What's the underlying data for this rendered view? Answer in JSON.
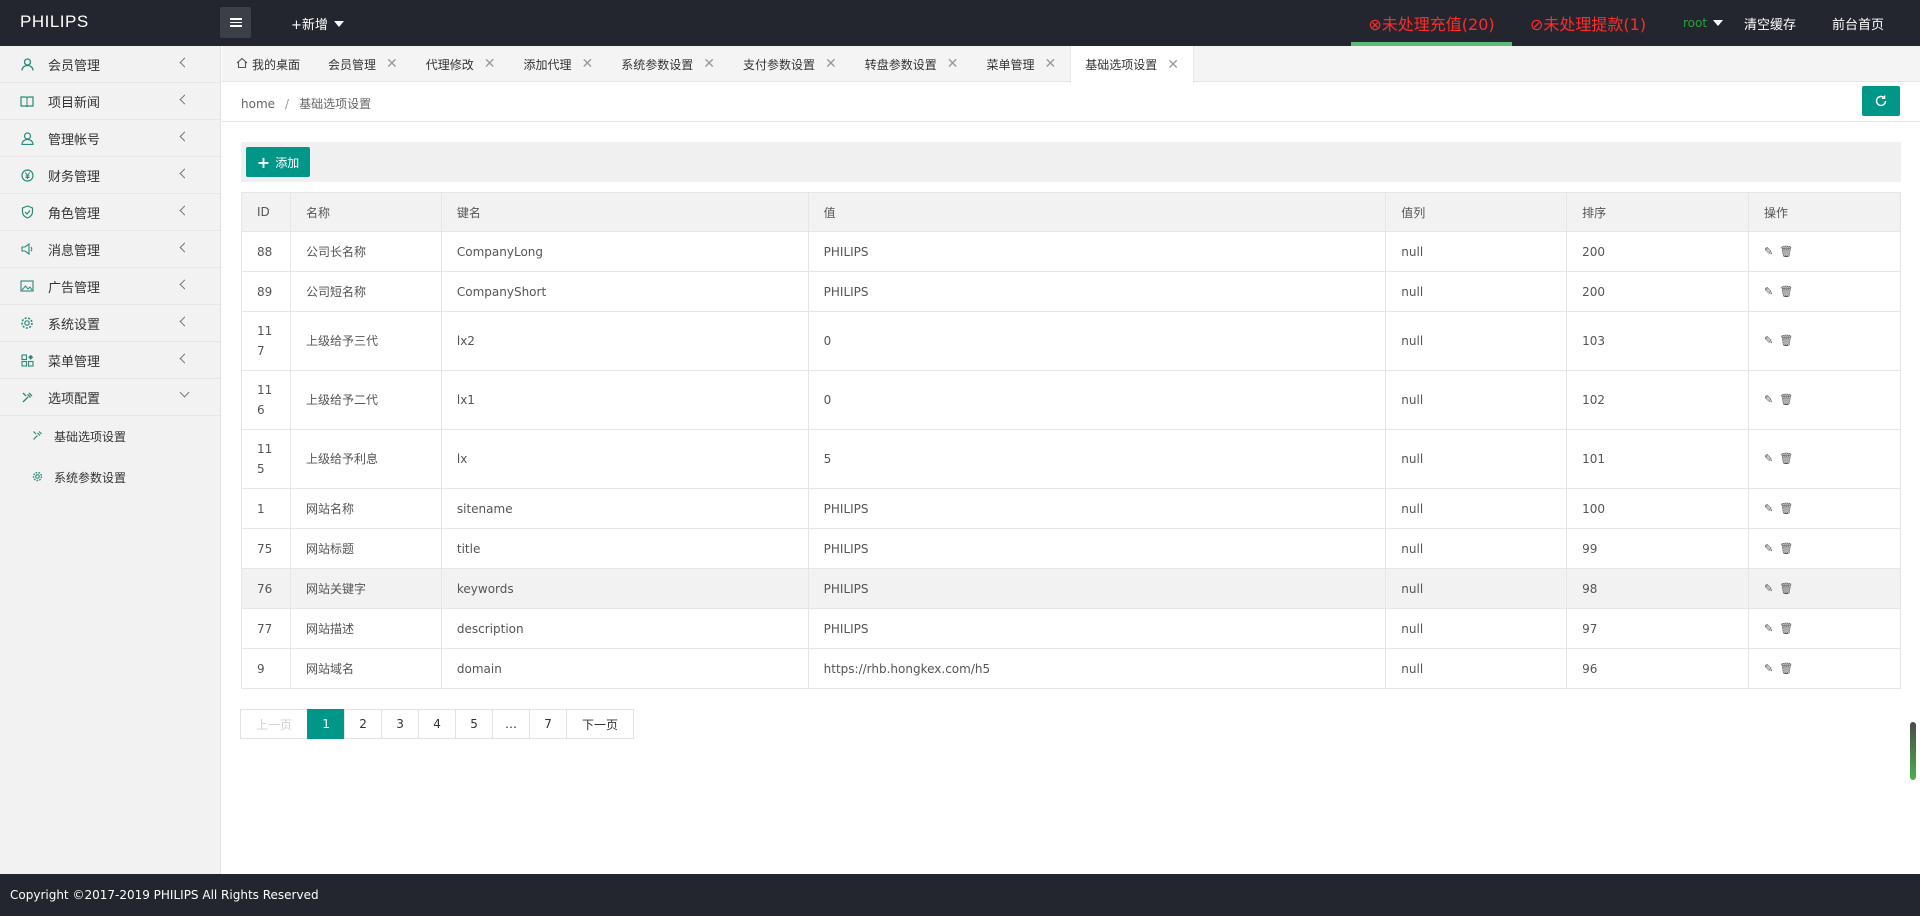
{
  "header": {
    "brand": "PHILIPS",
    "add_new": "+新增",
    "alert_recharge": "⊗未处理充值(20)",
    "alert_withdraw": "⊘未处理提款(1)",
    "user": "root",
    "clear_cache": "清空缓存",
    "front_home": "前台首页"
  },
  "sidebar": {
    "items": [
      {
        "label": "会员管理",
        "icon": "user-icon"
      },
      {
        "label": "项目新闻",
        "icon": "book-icon"
      },
      {
        "label": "管理帐号",
        "icon": "account-icon"
      },
      {
        "label": "财务管理",
        "icon": "yen-icon"
      },
      {
        "label": "角色管理",
        "icon": "shield-icon"
      },
      {
        "label": "消息管理",
        "icon": "speaker-icon"
      },
      {
        "label": "广告管理",
        "icon": "image-icon"
      },
      {
        "label": "系统设置",
        "icon": "gear-icon"
      },
      {
        "label": "菜单管理",
        "icon": "grid-icon"
      },
      {
        "label": "选项配置",
        "icon": "tools-icon"
      }
    ],
    "sub_items": [
      {
        "label": "基础选项设置",
        "icon": "tools-icon"
      },
      {
        "label": "系统参数设置",
        "icon": "gear-icon"
      }
    ]
  },
  "tabs": [
    {
      "label": "我的桌面"
    },
    {
      "label": "会员管理"
    },
    {
      "label": "代理修改"
    },
    {
      "label": "添加代理"
    },
    {
      "label": "系统参数设置"
    },
    {
      "label": "支付参数设置"
    },
    {
      "label": "转盘参数设置"
    },
    {
      "label": "菜单管理"
    },
    {
      "label": "基础选项设置"
    }
  ],
  "breadcrumb": {
    "home": "home",
    "sep": "/",
    "current": "基础选项设置"
  },
  "toolbar": {
    "add_label": "添加"
  },
  "table": {
    "headers": [
      "ID",
      "名称",
      "键名",
      "值",
      "值列",
      "排序",
      "操作"
    ],
    "rows": [
      {
        "id": "88",
        "name": "公司长名称",
        "key": "CompanyLong",
        "value": "PHILIPS",
        "col": "null",
        "sort": "200"
      },
      {
        "id": "89",
        "name": "公司短名称",
        "key": "CompanyShort",
        "value": "PHILIPS",
        "col": "null",
        "sort": "200"
      },
      {
        "id": "117",
        "id_l1": "11",
        "id_l2": "7",
        "name": "上级给予三代",
        "key": "lx2",
        "value": "0",
        "col": "null",
        "sort": "103"
      },
      {
        "id": "116",
        "id_l1": "11",
        "id_l2": "6",
        "name": "上级给予二代",
        "key": "lx1",
        "value": "0",
        "col": "null",
        "sort": "102"
      },
      {
        "id": "115",
        "id_l1": "11",
        "id_l2": "5",
        "name": "上级给予利息",
        "key": "lx",
        "value": "5",
        "col": "null",
        "sort": "101"
      },
      {
        "id": "1",
        "name": "网站名称",
        "key": "sitename",
        "value": "PHILIPS",
        "col": "null",
        "sort": "100"
      },
      {
        "id": "75",
        "name": "网站标题",
        "key": "title",
        "value": "PHILIPS",
        "col": "null",
        "sort": "99"
      },
      {
        "id": "76",
        "name": "网站关键字",
        "key": "keywords",
        "value": "PHILIPS",
        "col": "null",
        "sort": "98"
      },
      {
        "id": "77",
        "name": "网站描述",
        "key": "description",
        "value": "PHILIPS",
        "col": "null",
        "sort": "97"
      },
      {
        "id": "9",
        "name": "网站域名",
        "key": "domain",
        "value": "https://rhb.hongkex.com/h5",
        "col": "null",
        "sort": "96"
      }
    ]
  },
  "pagination": {
    "prev": "上一页",
    "pages": [
      "1",
      "2",
      "3",
      "4",
      "5",
      "…",
      "7"
    ],
    "current": "1",
    "next": "下一页"
  },
  "footer": {
    "copyright": "Copyright ©2017-2019 PHILIPS All Rights Reserved"
  },
  "colors": {
    "accent": "#009688",
    "topbar": "#23262e",
    "alert": "#ff2b2b"
  }
}
